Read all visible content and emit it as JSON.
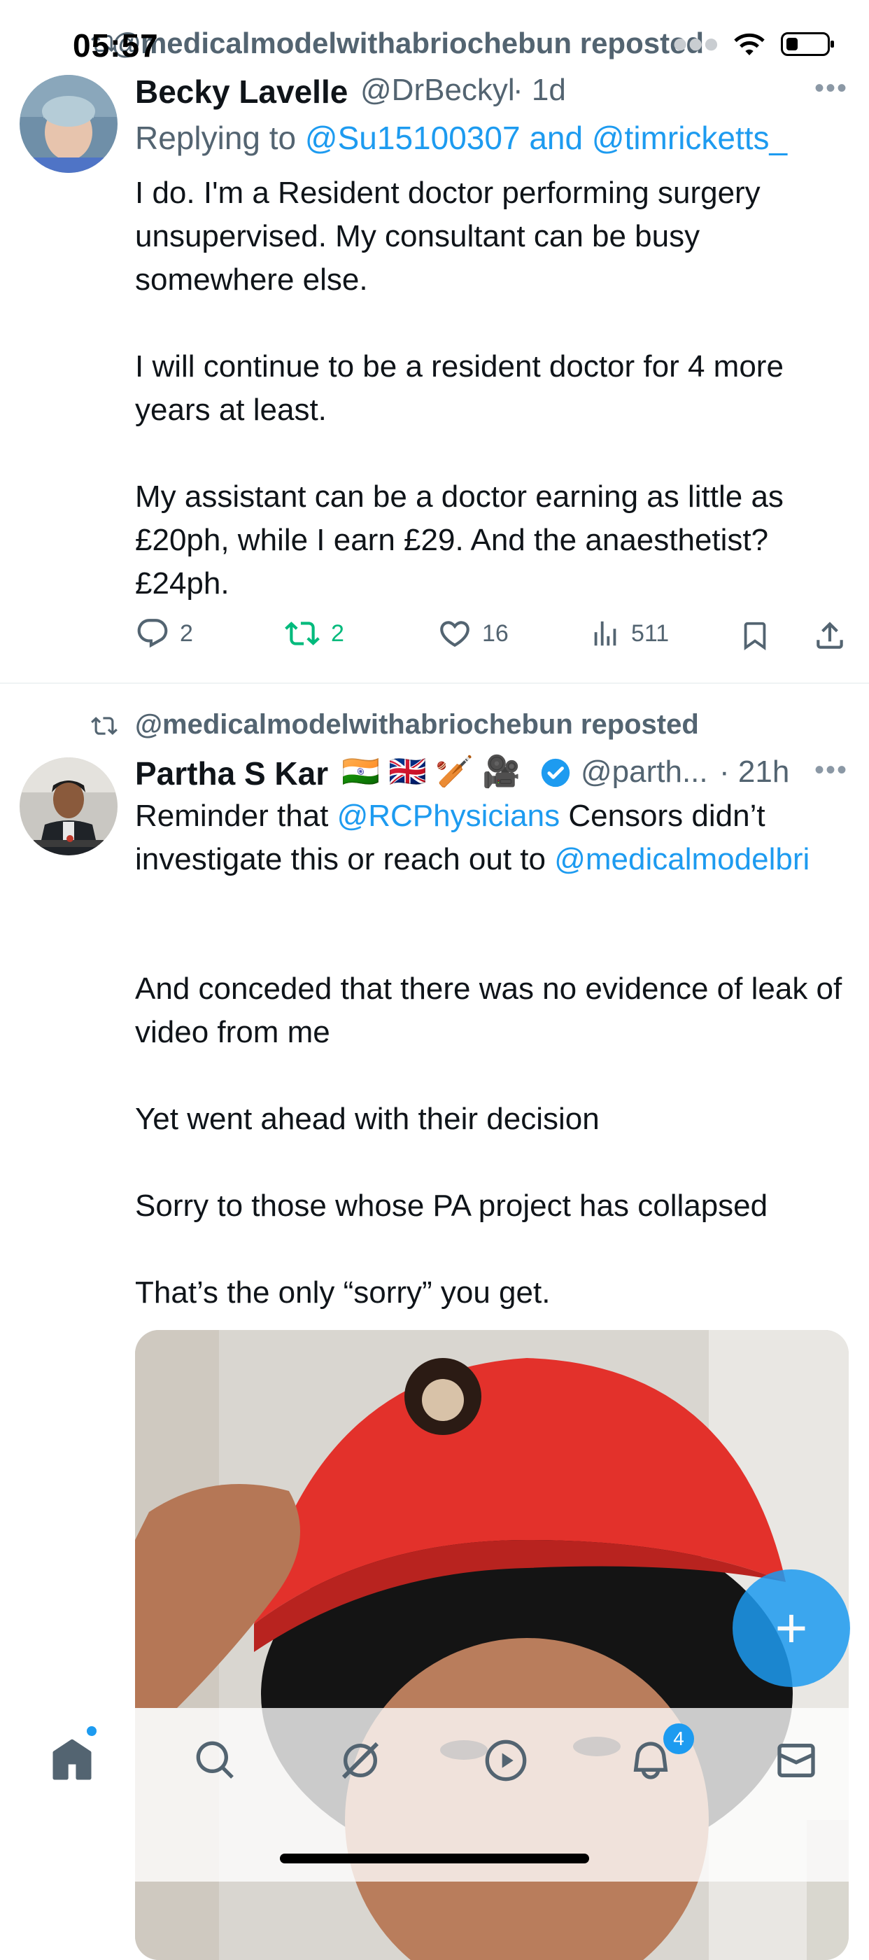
{
  "status_bar": {
    "time": "05:57"
  },
  "top_repost_label": "@medicalmodelwithabriochebun reposted",
  "tweet1": {
    "display_name": "Becky Lavelle",
    "handle": "@DrBeckyl",
    "time": "· 1d",
    "replying_prefix": "Replying to ",
    "replying_users": "@Su15100307 and @timricketts_",
    "text": "I do. I'm a Resident doctor performing surgery unsupervised. My consultant can be busy somewhere else.\n\nI will continue to be a resident doctor for 4 more years at least.\n\nMy assistant can be a doctor earning as little as £20ph, while I earn £29. And the anaesthetist? £24ph.",
    "replies": "2",
    "reposts": "2",
    "likes": "16",
    "views": "511"
  },
  "tweet2": {
    "repost_label": "@medicalmodelwithabriochebun reposted",
    "display_name": "Partha S Kar",
    "name_emojis": "🇮🇳 🇬🇧 🏏 🎥",
    "handle": "@parth...",
    "time": "· 21h",
    "text_prefix": "Reminder that ",
    "mention1": "@RCPhysicians",
    "text_mid": " Censors didn’t investigate this or reach out to ",
    "mention2": "@medicalmodelbri",
    "text_rest": "And conceded that there was no evidence of leak of video from me\n\nYet went ahead with their decision\n\nSorry to those whose PA project has collapsed\n\nThat’s the only “sorry” you get."
  },
  "fab": {
    "icon": "plus-icon",
    "label": "+"
  },
  "tabbar": {
    "items": [
      "home-icon",
      "search-icon",
      "grok-icon",
      "video-play-icon",
      "notifications-bell-icon",
      "messages-envelope-icon"
    ],
    "notifications_badge": "4"
  },
  "colors": {
    "accent": "#1d9bf0",
    "repost_green": "#00ba7c",
    "secondary_text": "#536471"
  }
}
